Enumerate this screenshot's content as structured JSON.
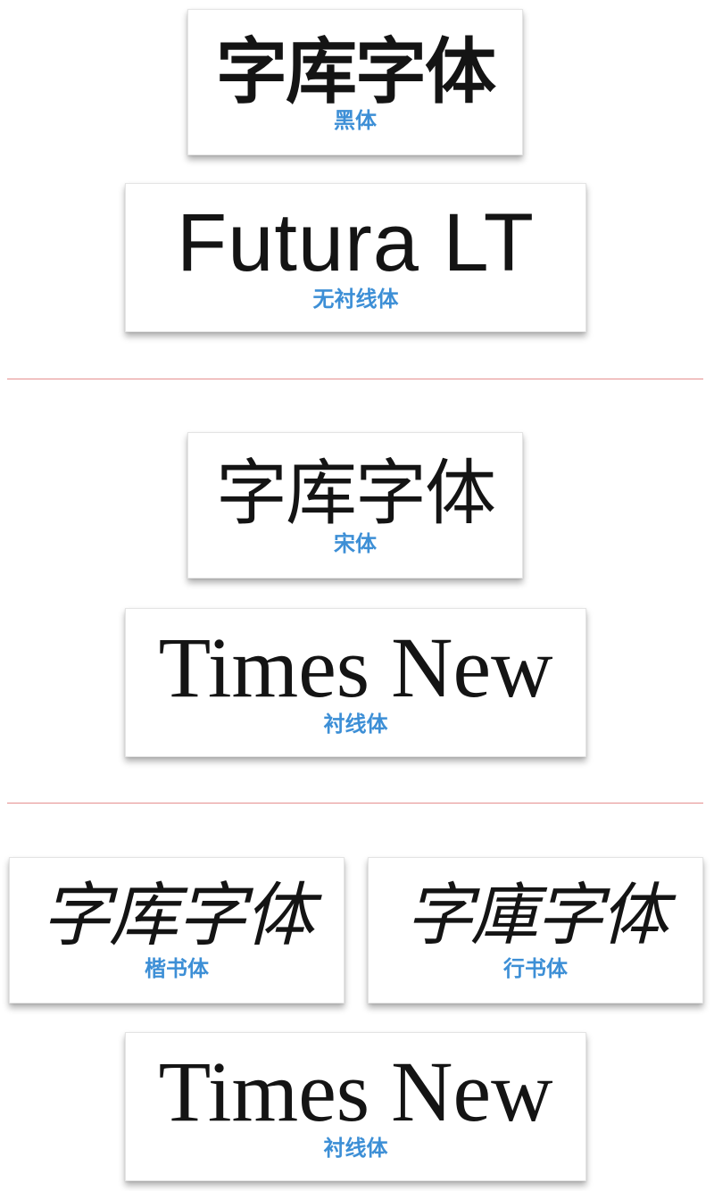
{
  "cards": [
    {
      "sample": "字库字体",
      "label": "黑体"
    },
    {
      "sample": "Futura LT",
      "label": "无衬线体"
    },
    {
      "sample": "字库字体",
      "label": "宋体"
    },
    {
      "sample": "Times New",
      "label": "衬线体"
    },
    {
      "sample": "字库字体",
      "label": "楷书体"
    },
    {
      "sample": "字庫字体",
      "label": "行书体"
    },
    {
      "sample": "Times New",
      "label": "衬线体"
    }
  ],
  "colors": {
    "label": "#3d8fd6",
    "divider": "#e58f8f",
    "sample_text": "#141414"
  }
}
